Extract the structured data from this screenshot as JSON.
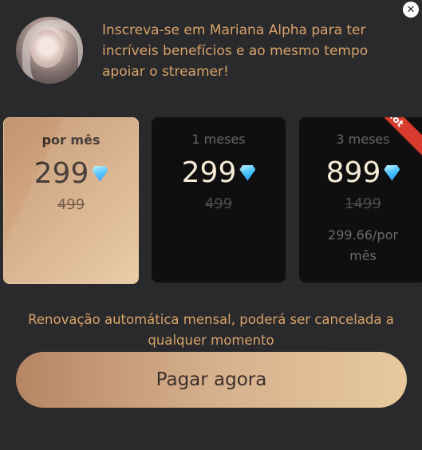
{
  "header": {
    "title": "Inscreva-se em Mariana Alpha para ter incríveis benefícios e ao mesmo tempo apoiar o streamer!"
  },
  "close_icon": "close-icon",
  "plans": [
    {
      "period": "por mês",
      "price": "299",
      "old_price": "499",
      "per_month": "",
      "selected": true
    },
    {
      "period": "1 meses",
      "price": "299",
      "old_price": "499",
      "per_month": "",
      "selected": false
    },
    {
      "period": "3 meses",
      "price": "899",
      "old_price": "1499",
      "per_month": "299.66/por mês",
      "badge": "Hot",
      "selected": false
    }
  ],
  "note": "Renovação automática mensal, poderá ser cancelada a qualquer momento",
  "pay_button": "Pagar agora",
  "colors": {
    "accent": "#d8a36a",
    "background": "#2a2a2c",
    "card": "#0f0f10",
    "badge": "#d93a2e"
  }
}
